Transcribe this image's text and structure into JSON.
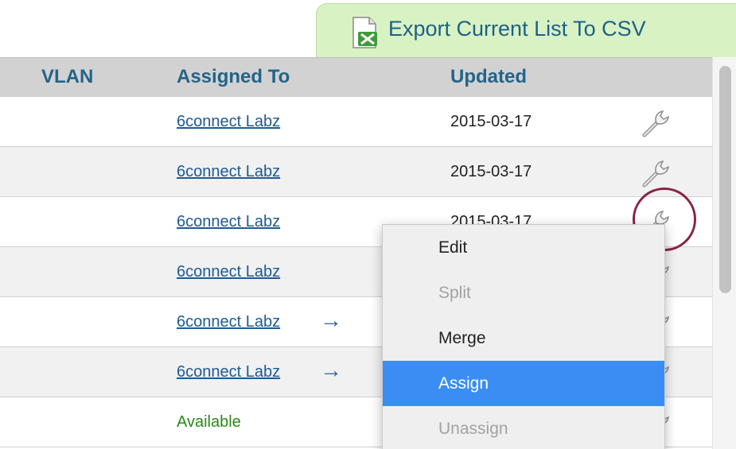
{
  "export_button": {
    "label": "Export Current List To CSV",
    "icon": "csv-export-icon"
  },
  "table": {
    "columns": {
      "vlan": "VLAN",
      "assigned_to": "Assigned To",
      "updated": "Updated"
    },
    "rows": [
      {
        "assigned_to": "6connect Labz",
        "updated": "2015-03-17",
        "arrow": ""
      },
      {
        "assigned_to": "6connect Labz",
        "updated": "2015-03-17",
        "arrow": ""
      },
      {
        "assigned_to": "6connect Labz",
        "updated": "2015-03-17",
        "arrow": ""
      },
      {
        "assigned_to": "6connect Labz",
        "updated": "",
        "arrow": ""
      },
      {
        "assigned_to": "6connect Labz",
        "updated": "",
        "arrow": "→"
      },
      {
        "assigned_to": "6connect Labz",
        "updated": "",
        "arrow": "→"
      },
      {
        "assigned_to": "Available",
        "updated": "",
        "arrow": ""
      }
    ]
  },
  "context_menu": {
    "items": [
      {
        "label": "Edit",
        "state": "enabled"
      },
      {
        "label": "Split",
        "state": "disabled"
      },
      {
        "label": "Merge",
        "state": "enabled"
      },
      {
        "label": "Assign",
        "state": "selected"
      },
      {
        "label": "Unassign",
        "state": "disabled"
      }
    ]
  },
  "colors": {
    "export_tab_bg": "#d9f2c4",
    "header_text": "#236489",
    "link": "#1f5a93",
    "available": "#2a8a17",
    "menu_selected": "#3a8ef3",
    "highlight_circle": "#8a2444"
  }
}
